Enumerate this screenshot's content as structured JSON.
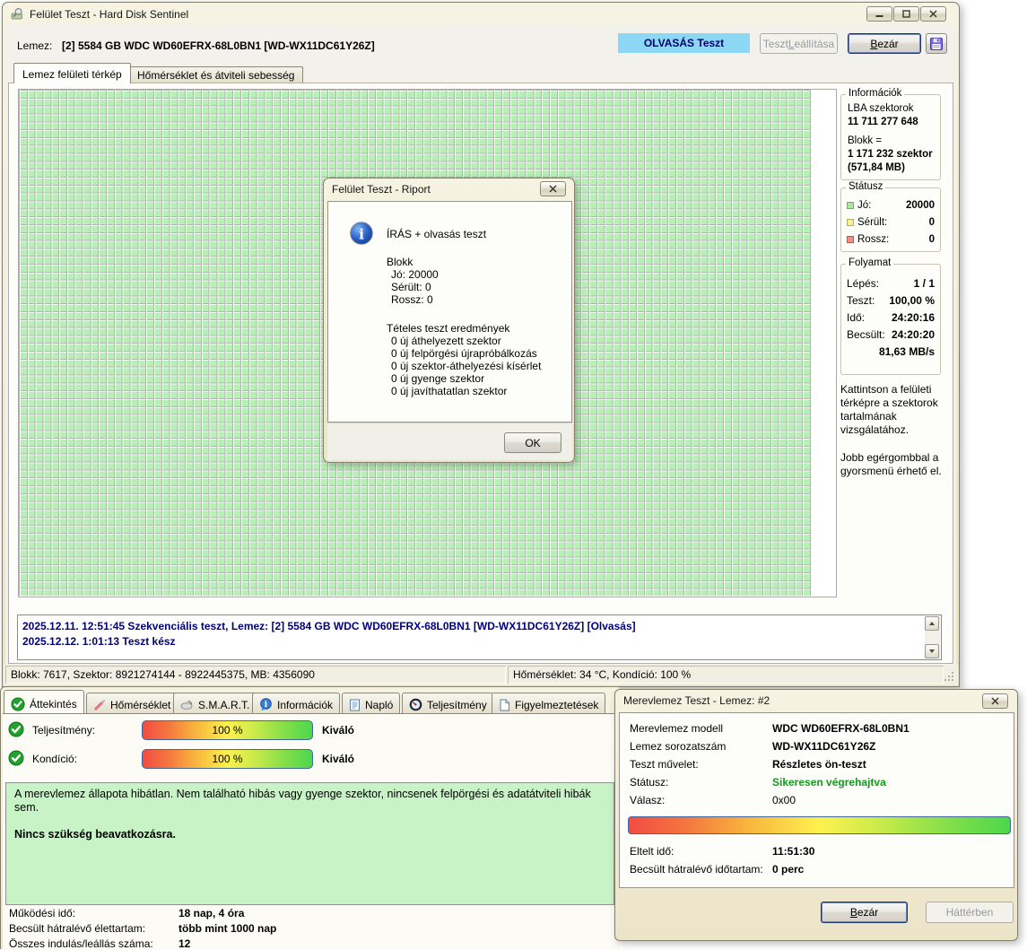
{
  "surface_window": {
    "title": "Felület Teszt - Hard Disk Sentinel",
    "disk": {
      "label": "Lemez:",
      "value": "[2] 5584 GB  WDC WD60EFRX-68L0BN1 [WD-WX11DC61Y26Z]"
    },
    "toolbar": {
      "test_mode_badge": "OLVASÁS Teszt",
      "stop_button": {
        "pre": "Teszt ",
        "accel": "L",
        "post": "eállítása"
      },
      "close_button": {
        "accel": "B",
        "post": "ezár"
      }
    },
    "tabs": [
      {
        "label": "Lemez felületi térkép",
        "active": true
      },
      {
        "label": "Hőmérséklet és átviteli sebesség",
        "active": false
      }
    ],
    "groups": {
      "info": {
        "title": "Információk",
        "lba_label": "LBA szektorok",
        "lba_value": "11 711 277 648",
        "block_label": "Blokk =",
        "block_value": "1 171 232 szektor",
        "block_size": "(571,84 MB)"
      },
      "status": {
        "title": "Státusz",
        "rows": [
          {
            "label": "Jó:",
            "value": "20000",
            "color": "#b2e3a6"
          },
          {
            "label": "Sérült:",
            "value": "0",
            "color": "#f3efa0"
          },
          {
            "label": "Rossz:",
            "value": "0",
            "color": "#ef8f88"
          }
        ]
      },
      "progress": {
        "title": "Folyamat",
        "rows": [
          {
            "label": "Lépés:",
            "value": "1 / 1"
          },
          {
            "label": "Teszt:",
            "value": "100,00 %"
          },
          {
            "label": "Idő:",
            "value": "24:20:16"
          },
          {
            "label": "Becsült:",
            "value": "24:20:20"
          }
        ],
        "speed": "81,63 MB/s"
      }
    },
    "hints": [
      "Kattintson a felületi térképre a szektorok tartalmának vizsgálatához.",
      "Jobb egérgombbal a gyorsmenü érhető el."
    ],
    "log": [
      "2025.12.11.  12:51:45   Szekvenciális teszt, Lemez: [2] 5584 GB  WDC WD60EFRX-68L0BN1 [WD-WX11DC61Y26Z] [Olvasás]",
      "2025.12.12.  1:01:13   Teszt kész"
    ],
    "statusbar": {
      "left": "Blokk: 7617, Szektor: 8921274144 - 8922445375, MB: 4356090",
      "right": "Hőmérséklet: 34  °C,  Kondíció: 100 %"
    }
  },
  "report_dialog": {
    "title": "Felület Teszt - Riport",
    "summary": "ÍRÁS + olvasás teszt",
    "block_section": {
      "header": "Blokk",
      "rows": [
        "Jó: 20000",
        "Sérült: 0",
        "Rossz: 0"
      ]
    },
    "details_section": {
      "header": "Tételes teszt eredmények",
      "rows": [
        "0 új áthelyezett szektor",
        "0 új felpörgési újrapróbálkozás",
        "0 új szektor-áthelyezési kísérlet",
        "0 új gyenge szektor",
        "0 új javíthatatlan szektor"
      ]
    },
    "ok_button": "OK"
  },
  "overview_window": {
    "tabs": [
      {
        "label": "Áttekintés",
        "icon": "check-icon",
        "active": true
      },
      {
        "label": "Hőmérséklet",
        "icon": "thermometer-icon",
        "active": false
      },
      {
        "label": "S.M.A.R.T.",
        "icon": "smart-icon",
        "active": false
      },
      {
        "label": "Információk",
        "icon": "info-balloon-icon",
        "active": false
      },
      {
        "label": "Napló",
        "icon": "log-icon",
        "active": false
      },
      {
        "label": "Teljesítmény",
        "icon": "gauge-icon",
        "active": false
      },
      {
        "label": "Figyelmeztetések",
        "icon": "alerts-icon",
        "active": false
      }
    ],
    "metrics": [
      {
        "label": "Teljesítmény:",
        "percent": "100 %",
        "rating": "Kiváló"
      },
      {
        "label": "Kondíció:",
        "percent": "100 %",
        "rating": "Kiváló"
      }
    ],
    "health_summary": {
      "text": "A merevlemez állapota hibátlan. Nem található hibás vagy gyenge szektor, nincsenek felpörgési és adatátviteli hibák sem.",
      "action": "Nincs szükség beavatkozásra."
    },
    "stats": [
      {
        "label": "Működési idő:",
        "value": "18 nap, 4 óra"
      },
      {
        "label": "Becsült hátralévő élettartam:",
        "value": "több mint 1000 nap"
      },
      {
        "label": "Összes indulás/leállás száma:",
        "value": "12"
      }
    ]
  },
  "test_window": {
    "title": "Merevlemez Teszt - Lemez: #2",
    "fields": [
      {
        "label": "Merevlemez modell",
        "value": "WDC WD60EFRX-68L0BN1"
      },
      {
        "label": "Lemez sorozatszám",
        "value": "WD-WX11DC61Y26Z"
      },
      {
        "label": "Teszt művelet:",
        "value": "Részletes ön-teszt"
      },
      {
        "label": "Státusz:",
        "value": "Sikeresen végrehajtva"
      },
      {
        "label": "Válasz:",
        "value": "0x00"
      }
    ],
    "progress_percent": 100,
    "times": [
      {
        "label": "Eltelt idő:",
        "value": "11:51:30"
      },
      {
        "label": "Becsült hátralévő időtartam:",
        "value": "0 perc"
      }
    ],
    "close_button": {
      "accel": "B",
      "post": "ezár"
    },
    "background_button": "Háttérben"
  },
  "colors": {
    "badge_bg": "#8cd8f4",
    "badge_text": "#00006e",
    "map_cell_green": "#b6f0b4",
    "status_good_square": "#b2e3a6",
    "status_damaged_square": "#f3efa0",
    "status_bad_square": "#ef8f88",
    "health_box_bg": "#c8f3c6",
    "success_text": "#14991e",
    "log_text": "#00007c",
    "bar_gradient": [
      "#f24c42",
      "#fdf14e",
      "#4cd74c"
    ]
  }
}
